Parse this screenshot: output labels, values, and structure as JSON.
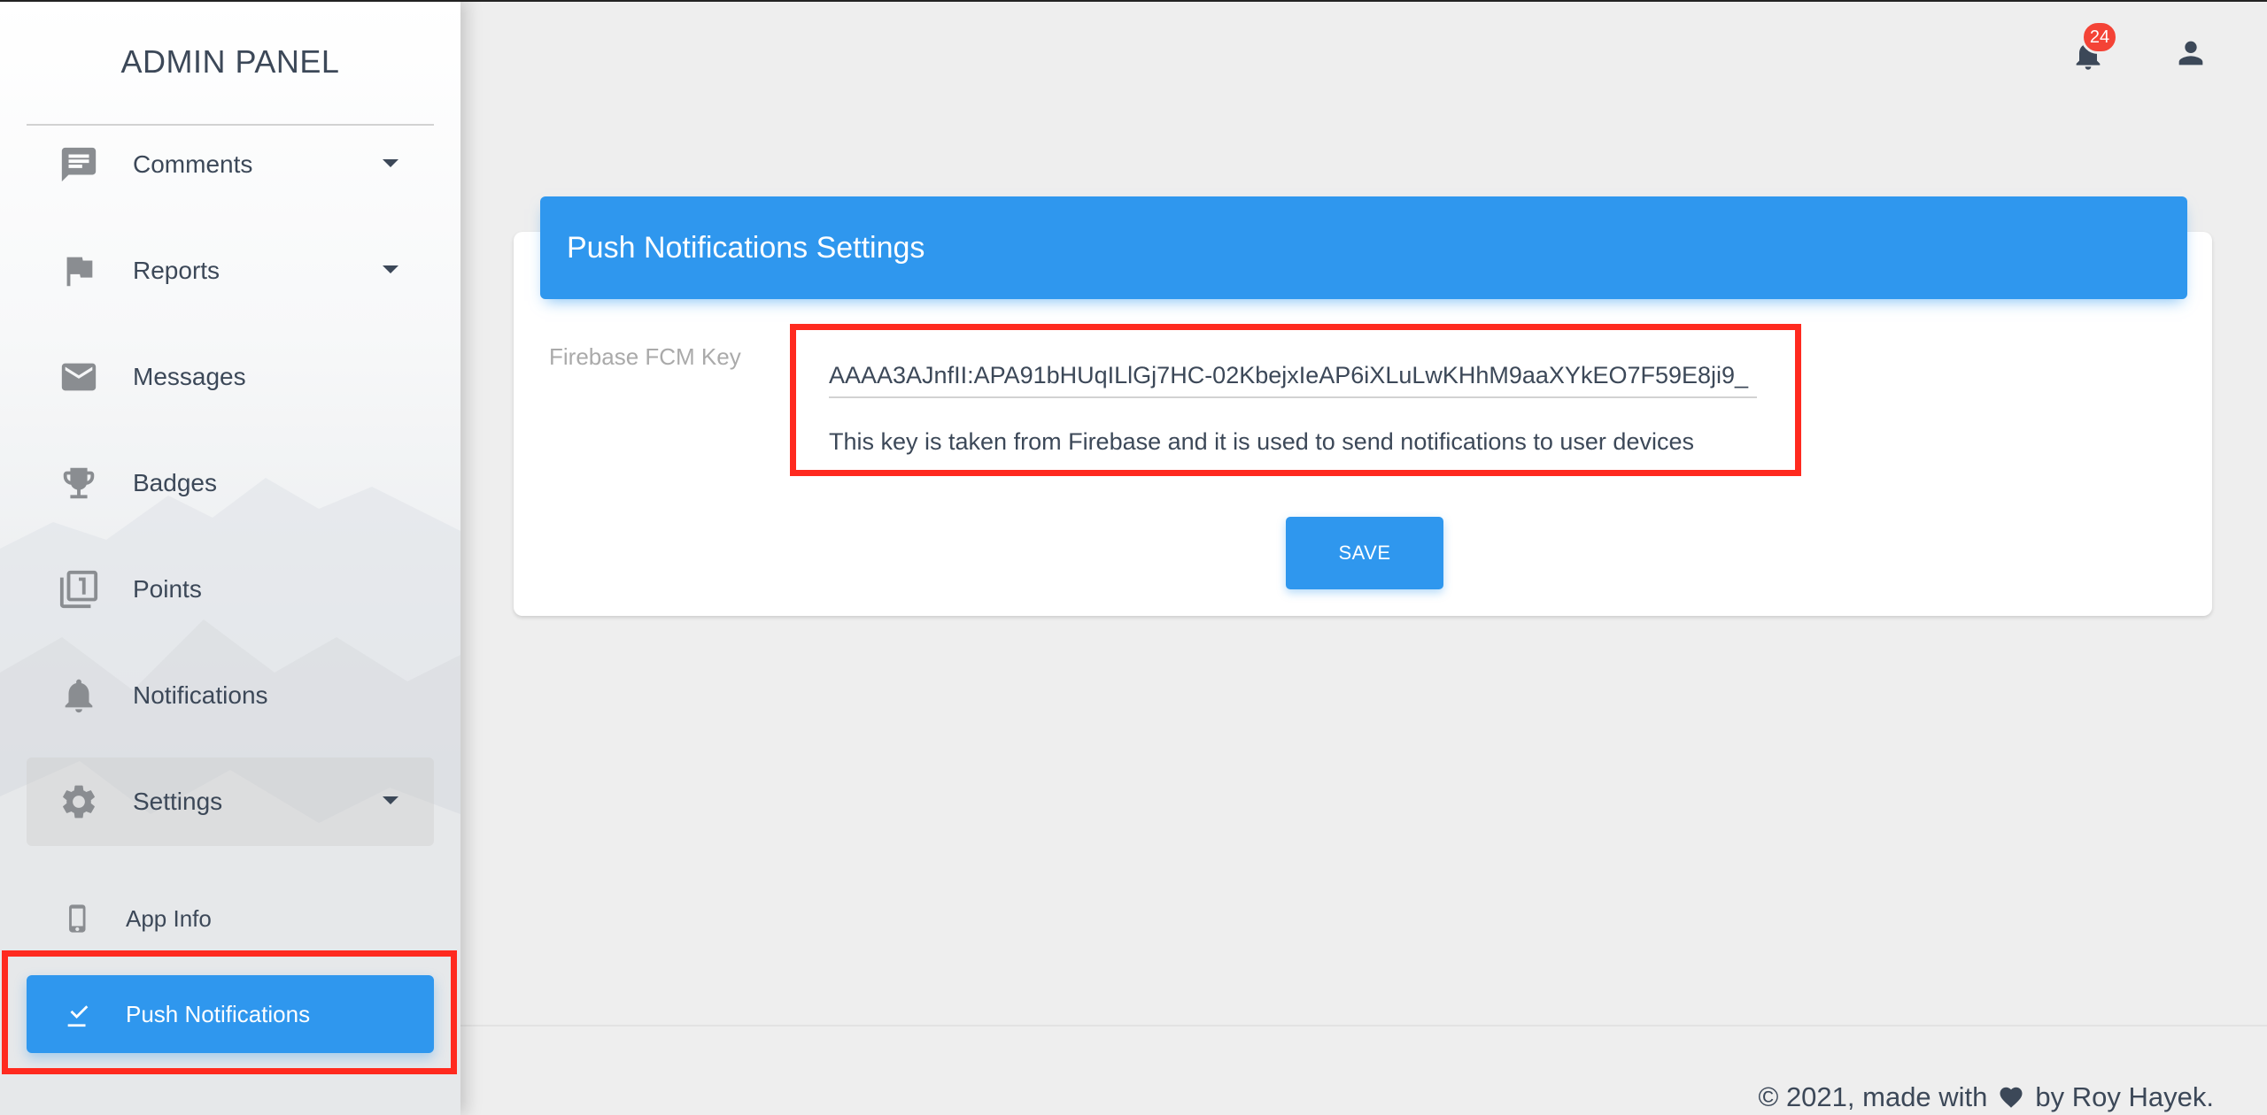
{
  "sidebar": {
    "brand": "ADMIN PANEL",
    "items": [
      {
        "label": "Comments",
        "icon": "comment-icon",
        "has_caret": true
      },
      {
        "label": "Reports",
        "icon": "flag-icon",
        "has_caret": true
      },
      {
        "label": "Messages",
        "icon": "mail-icon",
        "has_caret": false
      },
      {
        "label": "Badges",
        "icon": "trophy-icon",
        "has_caret": false
      },
      {
        "label": "Points",
        "icon": "filter-1-icon",
        "has_caret": false
      },
      {
        "label": "Notifications",
        "icon": "bell-icon",
        "has_caret": false
      },
      {
        "label": "Settings",
        "icon": "gear-icon",
        "has_caret": true,
        "expanded": true
      }
    ],
    "sub_items": [
      {
        "label": "App Info",
        "icon": "phone-icon"
      },
      {
        "label": "Push Notifications",
        "icon": "push-notification-icon",
        "selected": true
      }
    ]
  },
  "header": {
    "notification_count": "24"
  },
  "card": {
    "title": "Push Notifications Settings",
    "field_label": "Firebase FCM Key",
    "field_value": "AAAA3AJnfII:APA91bHUqILlGj7HC-02KbejxIeAP6iXLuLwKHhM9aaXYkEO7F59E8ji9_",
    "helper_text": "This key is taken from Firebase and it is used to send notifications to user devices",
    "save_label": "SAVE"
  },
  "footer": {
    "prefix": "© 2021, made with",
    "suffix": "by Roy Hayek."
  },
  "colors": {
    "primary": "#2f97ee",
    "highlight": "#ff2a1f",
    "badge": "#f44336"
  }
}
